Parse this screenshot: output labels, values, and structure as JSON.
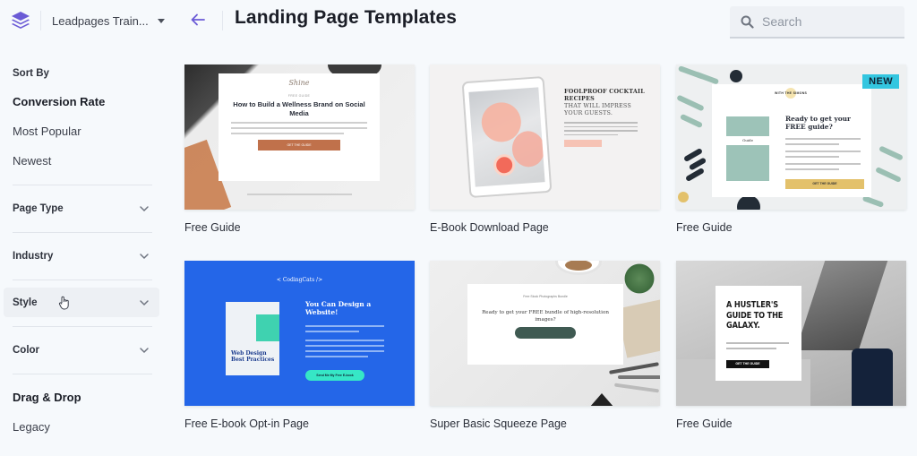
{
  "header": {
    "workspace_name": "Leadpages Train...",
    "page_title": "Landing Page Templates",
    "search_placeholder": "Search",
    "search_value": "",
    "accent_color": "#6b5bd6"
  },
  "sidebar": {
    "sort_by_label": "Sort By",
    "sort_options": [
      {
        "label": "Conversion Rate",
        "active": true
      },
      {
        "label": "Most Popular",
        "active": false
      },
      {
        "label": "Newest",
        "active": false
      }
    ],
    "filters": [
      {
        "label": "Page Type",
        "icon": "chevron-down-icon"
      },
      {
        "label": "Industry",
        "icon": "chevron-down-icon"
      },
      {
        "label": "Style",
        "icon": "chevron-down-icon",
        "hovered": true
      },
      {
        "label": "Color",
        "icon": "chevron-down-icon"
      }
    ],
    "editor_types": [
      {
        "label": "Drag & Drop",
        "active": true
      },
      {
        "label": "Legacy",
        "active": false
      }
    ]
  },
  "templates": [
    {
      "label": "Free Guide",
      "badge": null,
      "preview": {
        "brand": "Shine",
        "kicker": "FREE GUIDE",
        "headline": "How to Build a Wellness Brand on Social Media",
        "button": "GET THE GUIDE"
      }
    },
    {
      "label": "E-Book Download Page",
      "badge": null,
      "preview": {
        "headline_bold": "FOOLPROOF COCKTAIL RECIPES",
        "headline_light": "THAT WILL IMPRESS YOUR GUESTS."
      }
    },
    {
      "label": "Free Guide",
      "badge": "NEW",
      "preview": {
        "book_title": "Guide",
        "headline": "Ready to get your FREE guide?",
        "button": "GET THE GUIDE"
      }
    },
    {
      "label": "Free E-book Opt-in Page",
      "badge": null,
      "preview": {
        "brand": "< CodingCats />",
        "book_title": "Web Design Best Practices",
        "headline": "You Can Design a Website!"
      }
    },
    {
      "label": "Super Basic Squeeze Page",
      "badge": null,
      "preview": {
        "kicker": "Free Stock Photographs Bundle",
        "headline": "Ready to get your FREE bundle of high-resolution images?"
      }
    },
    {
      "label": "Free Guide",
      "badge": null,
      "preview": {
        "headline": "A HUSTLER'S GUIDE TO THE GALAXY.",
        "button": "GET THE GUIDE"
      }
    }
  ]
}
